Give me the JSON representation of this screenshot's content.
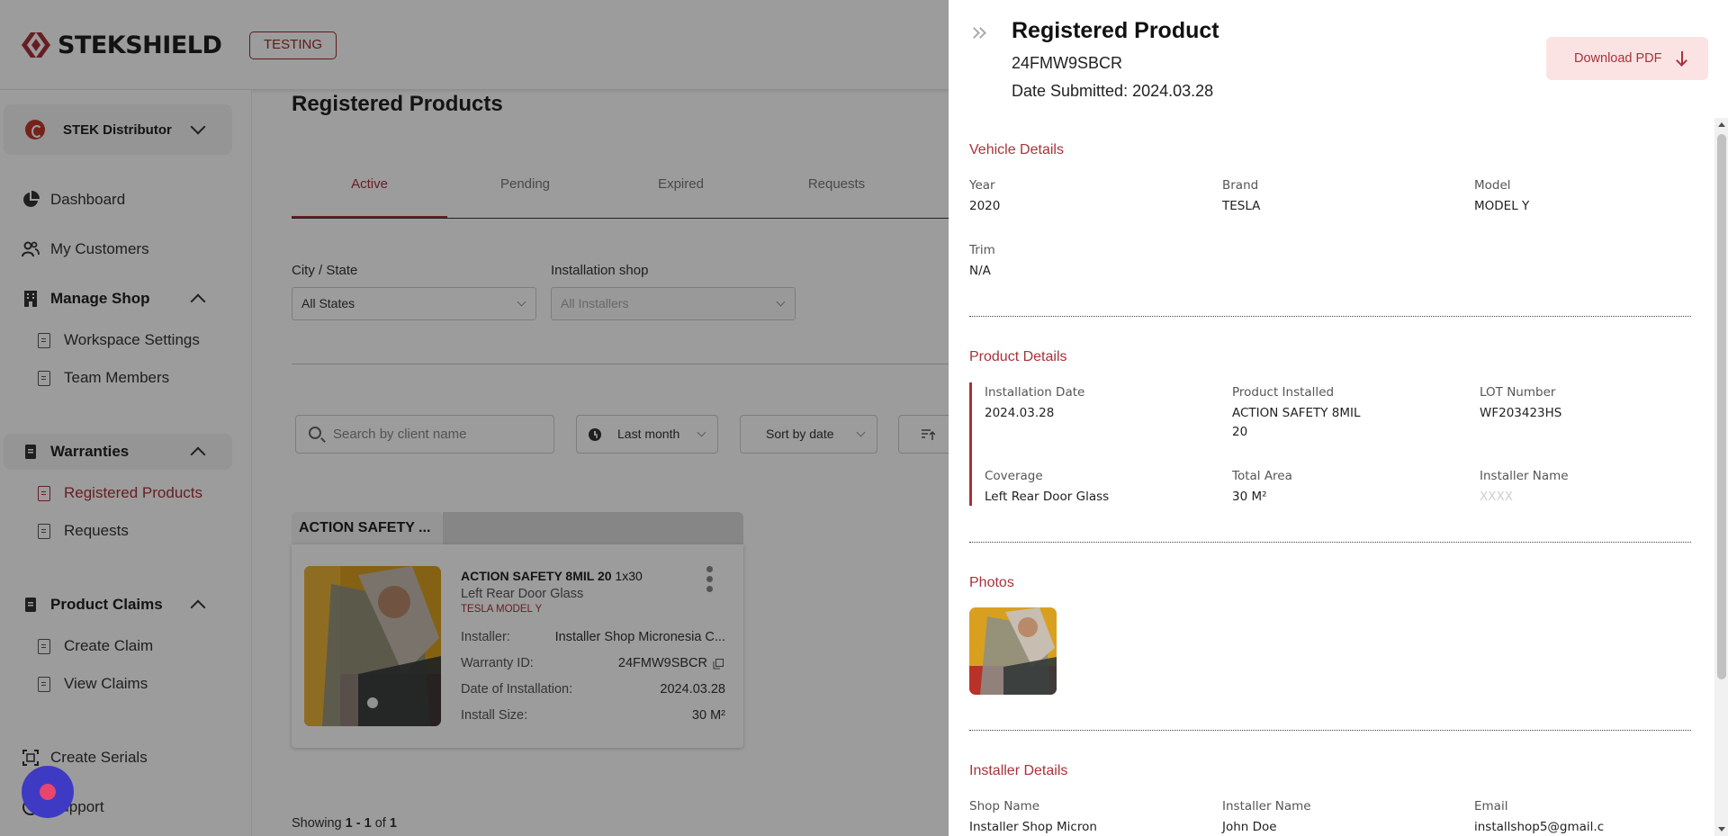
{
  "brand": {
    "name": "STEKSHIELD",
    "env_badge": "TESTING"
  },
  "sidebar": {
    "distributor": "STEK Distributor",
    "items": [
      {
        "label": "Dashboard"
      },
      {
        "label": "My Customers"
      }
    ],
    "sections": [
      {
        "label": "Manage Shop",
        "children": [
          "Workspace Settings",
          "Team Members"
        ]
      },
      {
        "label": "Warranties",
        "children": [
          "Registered Products",
          "Requests"
        ]
      },
      {
        "label": "Product Claims",
        "children": [
          "Create Claim",
          "View Claims"
        ]
      }
    ],
    "bottom": [
      "Create Serials",
      "Support"
    ]
  },
  "main": {
    "title": "Registered Products",
    "tabs": [
      "Active",
      "Pending",
      "Expired",
      "Requests"
    ],
    "filters": {
      "city_label": "City / State",
      "city_value": "All States",
      "shop_label": "Installation shop",
      "shop_value": "All Installers"
    },
    "search_placeholder": "Search by client name",
    "period": "Last month",
    "sort": "Sort by date",
    "group_label": "ACTION SAFETY ...",
    "card": {
      "title": "ACTION SAFETY 8MIL 20",
      "size": "1x30",
      "coverage": "Left Rear Door Glass",
      "vehicle": "TESLA MODEL Y",
      "installer_label": "Installer:",
      "installer_value": "Installer Shop Micronesia C...",
      "warranty_label": "Warranty ID:",
      "warranty_value": "24FMW9SBCR",
      "date_label": "Date of Installation:",
      "date_value": "2024.03.28",
      "install_size_label": "Install Size:",
      "install_size_value": "30 M²"
    },
    "showing": {
      "prefix": "Showing ",
      "range": "1 - 1",
      "mid": " of ",
      "total": "1"
    }
  },
  "drawer": {
    "title": "Registered Product",
    "warranty_id": "24FMW9SBCR",
    "date_submitted": "Date Submitted: 2024.03.28",
    "download_label": "Download PDF",
    "vehicle": {
      "heading": "Vehicle Details",
      "year_label": "Year",
      "year": "2020",
      "brand_label": "Brand",
      "brand": "TESLA",
      "model_label": "Model",
      "model": "MODEL Y",
      "trim_label": "Trim",
      "trim": "N/A"
    },
    "product": {
      "heading": "Product Details",
      "install_date_label": "Installation Date",
      "install_date": "2024.03.28",
      "product_label": "Product Installed",
      "product_line1": "ACTION SAFETY 8MIL",
      "product_line2": "20",
      "lot_label": "LOT Number",
      "lot": "WF203423HS",
      "coverage_label": "Coverage",
      "coverage": "Left Rear Door Glass",
      "area_label": "Total Area",
      "area": "30 M²",
      "installer_label": "Installer Name",
      "installer": "XXXX"
    },
    "photos_heading": "Photos",
    "installer": {
      "heading": "Installer Details",
      "shop_label": "Shop Name",
      "shop": "Installer Shop Micron",
      "name_label": "Installer Name",
      "name": "John Doe",
      "email_label": "Email",
      "email": "installshop5@gmail.c"
    }
  },
  "colors": {
    "accent": "#a8323a",
    "chat": "#3f3ac4"
  }
}
